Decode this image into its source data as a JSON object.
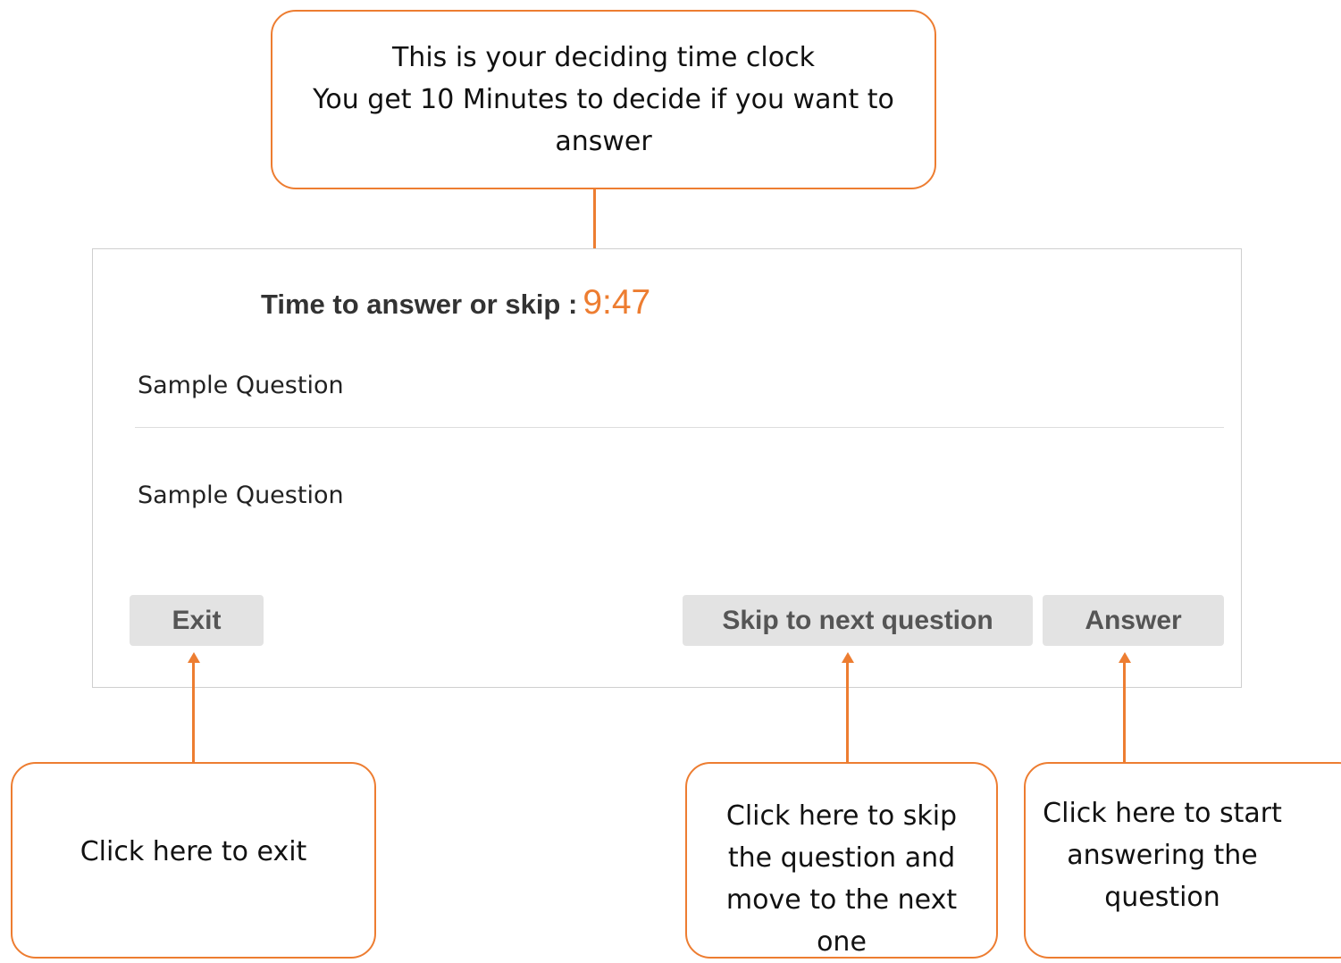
{
  "callouts": {
    "timer": [
      "This is your deciding time clock",
      "You get 10 Minutes to decide if you want to",
      "answer"
    ],
    "exit": [
      "Click here to exit"
    ],
    "skip": [
      "Click here to skip",
      "the question and",
      "move to the next",
      "one"
    ],
    "answer": [
      "Click here to start",
      "answering the",
      "question"
    ]
  },
  "panel": {
    "timer_label": "Time to answer or skip :",
    "timer_value": "9:47",
    "questions": [
      "Sample Question",
      "Sample Question"
    ],
    "buttons": {
      "exit": "Exit",
      "skip": "Skip to next question",
      "answer": "Answer"
    }
  },
  "colors": {
    "accent": "#ED7D31",
    "button_bg": "#e3e3e3",
    "button_text": "#555555"
  }
}
